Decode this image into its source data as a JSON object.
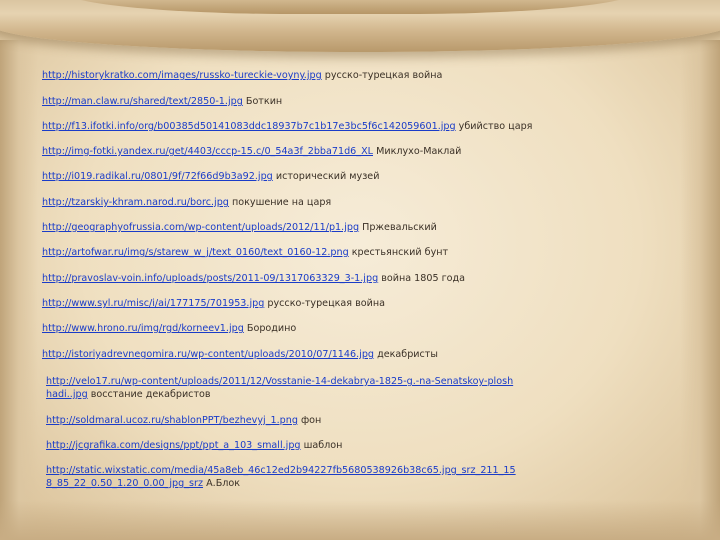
{
  "links": [
    {
      "url": "http://historykratko.com/images/russko-tureckie-voyny.jpg",
      "desc": "русско-турецкая война"
    },
    {
      "url": "http://man.claw.ru/shared/text/2850-1.jpg",
      "desc": "Боткин"
    },
    {
      "url": "http://f13.ifotki.info/org/b00385d50141083ddc18937b7c1b17e3bc5f6c142059601.jpg",
      "desc": "убийство царя"
    },
    {
      "url": "http://img-fotki.yandex.ru/get/4403/cccp-15.c/0_54a3f_2bba71d6_XL",
      "desc": "Миклухо-Маклай"
    },
    {
      "url": "http://i019.radikal.ru/0801/9f/72f66d9b3a92.jpg",
      "desc": "исторический музей"
    },
    {
      "url": "http://tzarskiy-khram.narod.ru/borc.jpg",
      "desc": "покушение на царя"
    },
    {
      "url": "http://geographyofrussia.com/wp-content/uploads/2012/11/p1.jpg",
      "desc": "Пржевальский"
    },
    {
      "url": "http://artofwar.ru/img/s/starew_w_j/text_0160/text_0160-12.png",
      "desc": "крестьянский бунт"
    },
    {
      "url": "http://pravoslav-voin.info/uploads/posts/2011-09/1317063329_3-1.jpg",
      "desc": "война 1805 года"
    },
    {
      "url": "http://www.syl.ru/misc/i/ai/177175/701953.jpg",
      "desc": "русско-турецкая война"
    },
    {
      "url": "http://www.hrono.ru/img/rgd/korneev1.jpg",
      "desc": "Бородино"
    },
    {
      "url": "http://istoriyadrevnegomira.ru/wp-content/uploads/2010/07/1146.jpg",
      "desc": "декабристы"
    },
    {
      "url": "http://velo17.ru/wp-content/uploads/2011/12/Vosstanie-14-dekabrya-1825-g.-na-Senatskoy-ploshhadi..jpg",
      "desc": "восстание декабристов"
    },
    {
      "url": "http://soldmaral.ucoz.ru/shablonPPT/bezhevyj_1.png",
      "desc": "фон"
    },
    {
      "url": "http://jcgrafika.com/designs/ppt/ppt_a_103_small.jpg",
      "desc": "шаблон"
    },
    {
      "url": "http://static.wixstatic.com/media/45a8eb_46c12ed2b94227fb5680538926b38c65.jpg_srz_211_158_85_22_0.50_1.20_0.00_jpg_srz",
      "desc": "А.Блок"
    }
  ]
}
